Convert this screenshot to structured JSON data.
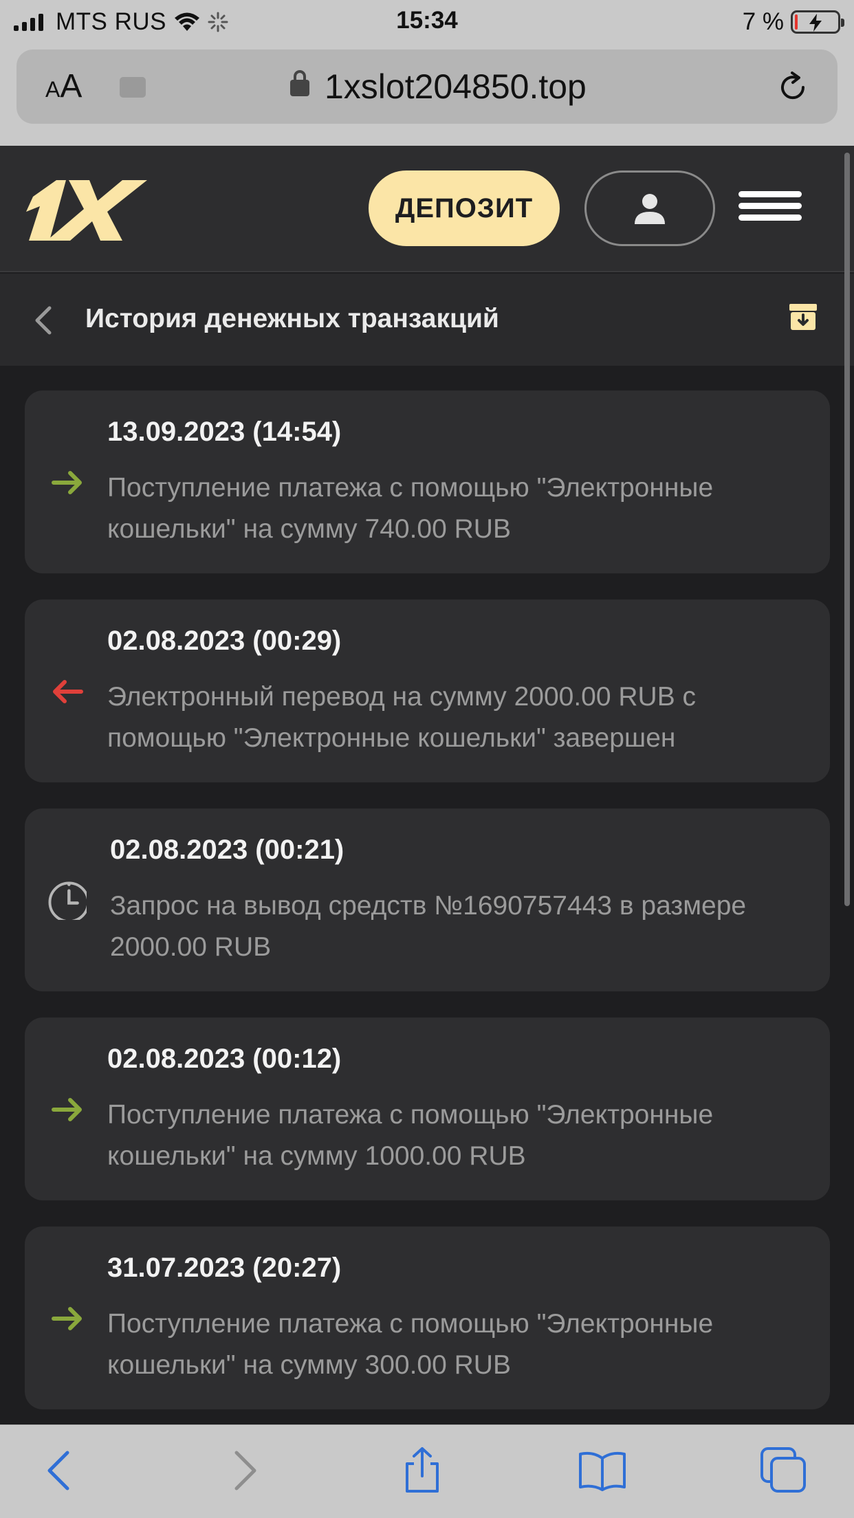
{
  "status_bar": {
    "carrier": "MTS RUS",
    "time": "15:34",
    "battery_percent": "7 %",
    "battery_level": 0.07,
    "battery_color": "#e5342d"
  },
  "browser": {
    "aa_label_small": "A",
    "aa_label_big": "A",
    "url": "1xslot204850.top",
    "icons": [
      "extension-icon",
      "lock-icon",
      "reload-icon"
    ]
  },
  "site_header": {
    "logo_text": "1X",
    "deposit_label": "ДЕПОЗИТ",
    "accent_color": "#fbe5a7",
    "icons": [
      "user-icon",
      "hamburger-menu-icon"
    ]
  },
  "sub_header": {
    "title": "История денежных транзакций",
    "icons": [
      "chevron-left-icon",
      "archive-download-icon"
    ]
  },
  "transactions": [
    {
      "date": "13.09.2023 (14:54)",
      "description": "Поступление платежа с помощью \"Электронные кошельки\" на сумму 740.00 RUB",
      "type": "incoming",
      "icon": "arrow-right-icon",
      "icon_color": "#8aa83c"
    },
    {
      "date": "02.08.2023 (00:29)",
      "description": "Электронный перевод на сумму 2000.00 RUB с помощью \"Электронные кошельки\" завершен",
      "type": "outgoing",
      "icon": "arrow-left-icon",
      "icon_color": "#e0403a"
    },
    {
      "date": "02.08.2023 (00:21)",
      "description": "Запрос на вывод средств №1690757443 в размере 2000.00 RUB",
      "type": "pending",
      "icon": "clock-icon",
      "icon_color": "#b5b5b5"
    },
    {
      "date": "02.08.2023 (00:12)",
      "description": "Поступление платежа с помощью \"Электронные кошельки\" на сумму 1000.00 RUB",
      "type": "incoming",
      "icon": "arrow-right-icon",
      "icon_color": "#8aa83c"
    },
    {
      "date": "31.07.2023 (20:27)",
      "description": "Поступление платежа с помощью \"Электронные кошельки\" на сумму 300.00 RUB",
      "type": "incoming",
      "icon": "arrow-right-icon",
      "icon_color": "#8aa83c"
    }
  ],
  "toolbar": {
    "icons": [
      "back-icon",
      "forward-icon",
      "share-icon",
      "bookmarks-icon",
      "tabs-icon"
    ],
    "tint": "#2f6fd6"
  }
}
